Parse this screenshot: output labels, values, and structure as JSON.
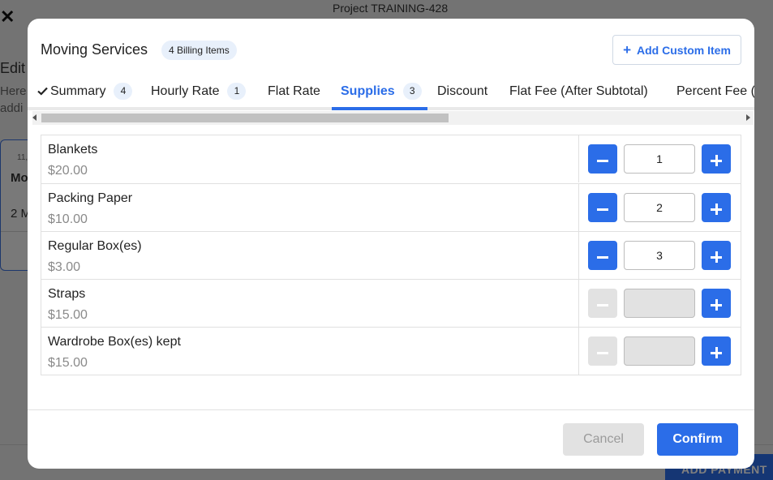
{
  "background": {
    "close_glyph": "✕",
    "project_title": "Project TRAINING-428",
    "edit_text": "Edit",
    "here_text": "Here",
    "addi_text": "addi",
    "card_date": "11,",
    "card_title": "Mo",
    "card_sub": "2 M",
    "right_link": "it",
    "add_payment_label": "ADD PAYMENT"
  },
  "modal": {
    "title": "Moving Services",
    "billing_badge": "4 Billing Items",
    "add_custom_label": "Add Custom Item",
    "tabs": [
      {
        "label": "Summary",
        "count": "4",
        "checked": true
      },
      {
        "label": "Hourly Rate",
        "count": "1"
      },
      {
        "label": "Flat Rate",
        "count": ""
      },
      {
        "label": "Supplies",
        "count": "3",
        "active": true
      },
      {
        "label": "Discount",
        "count": ""
      },
      {
        "label": "Flat Fee (After Subtotal)",
        "count": ""
      },
      {
        "label": "Percent Fee (",
        "count": ""
      }
    ],
    "items": [
      {
        "name": "Blankets",
        "price": "$20.00",
        "quantity": "1",
        "enabled": true
      },
      {
        "name": "Packing Paper",
        "price": "$10.00",
        "quantity": "2",
        "enabled": true
      },
      {
        "name": "Regular Box(es)",
        "price": "$3.00",
        "quantity": "3",
        "enabled": true
      },
      {
        "name": "Straps",
        "price": "$15.00",
        "quantity": "",
        "enabled": false
      },
      {
        "name": "Wardrobe Box(es) kept",
        "price": "$15.00",
        "quantity": "",
        "enabled": false
      }
    ],
    "cancel_label": "Cancel",
    "confirm_label": "Confirm"
  },
  "colors": {
    "accent": "#2b6de8",
    "badge_bg": "#e8f0fb",
    "disabled": "#e2e2e2"
  },
  "icons": {
    "check": "check-icon",
    "plus": "plus-icon",
    "minus": "minus-icon",
    "close": "close-icon"
  }
}
